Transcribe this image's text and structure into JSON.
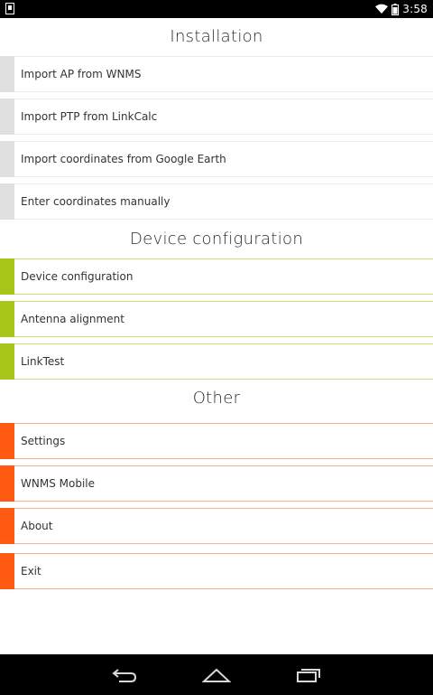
{
  "status_bar": {
    "time": "3:58",
    "icons": [
      "notification-icon",
      "wifi-icon",
      "battery-icon"
    ]
  },
  "sections": [
    {
      "title": "Installation",
      "accent_color": "#e0e0e0",
      "border_color": "#ececec",
      "items": [
        {
          "label": "Import AP from WNMS"
        },
        {
          "label": "Import PTP from LinkCalc"
        },
        {
          "label": "Import coordinates from Google Earth"
        },
        {
          "label": "Enter coordinates manually"
        }
      ]
    },
    {
      "title": "Device configuration",
      "accent_color": "#a6c71a",
      "border_color": "#c8de7c",
      "items": [
        {
          "label": "Device configuration"
        },
        {
          "label": "Antenna alignment"
        },
        {
          "label": "LinkTest"
        }
      ]
    },
    {
      "title": "Other",
      "accent_color": "#ff5a12",
      "border_color": "#f7b08a",
      "items": [
        {
          "label": "Settings"
        },
        {
          "label": "WNMS Mobile"
        },
        {
          "label": "About"
        },
        {
          "label": "Exit"
        }
      ]
    }
  ],
  "nav_bar": {
    "buttons": [
      "back-icon",
      "home-icon",
      "recent-apps-icon"
    ]
  }
}
